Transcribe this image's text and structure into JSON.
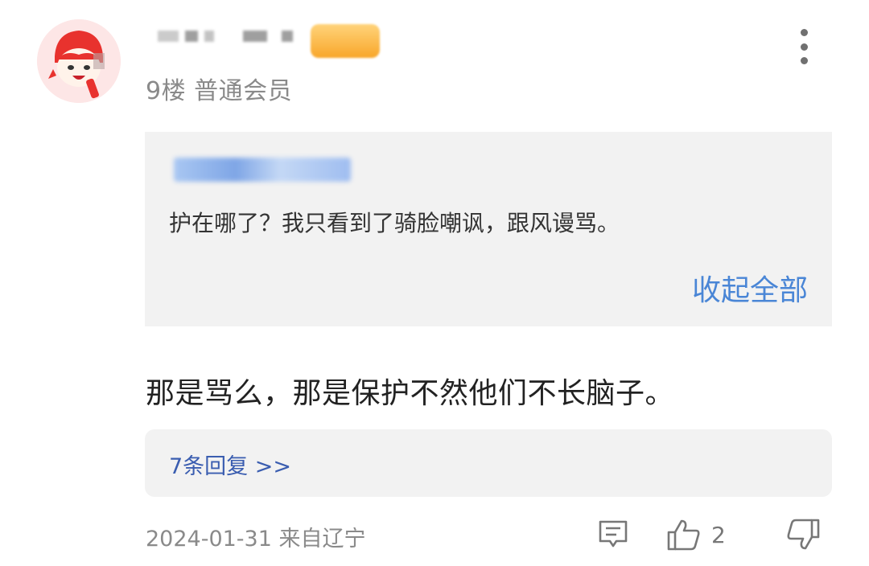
{
  "post": {
    "floor_info": "9楼 普通会员",
    "quote": {
      "text": "护在哪了？我只看到了骑脸嘲讽，跟风谩骂。",
      "collapse_label": "收起全部"
    },
    "content": "那是骂么，那是保护不然他们不长脑子。",
    "replies_label": "7条回复 >>",
    "meta": "2024-01-31 来自辽宁",
    "likes": "2"
  },
  "icons": {
    "menu": "more-vertical-icon",
    "comment": "comment-icon",
    "like": "thumbs-up-icon",
    "dislike": "thumbs-down-icon"
  },
  "colors": {
    "link_blue": "#4a86d6",
    "replies_blue": "#3a5db0",
    "gray_text": "#8a8a8a",
    "box_bg": "#f2f2f2",
    "avatar_red": "#e8322e"
  }
}
